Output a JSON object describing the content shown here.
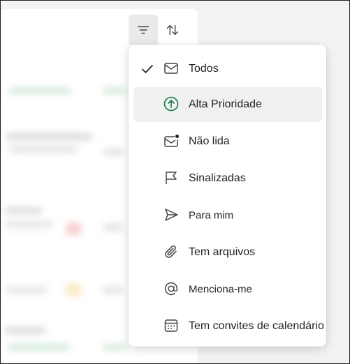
{
  "menu": {
    "items": [
      {
        "label": "Todos",
        "icon": "mail-icon",
        "checked": true
      },
      {
        "label": "Alta Prioridade",
        "icon": "arrow-up-circle-icon",
        "highlighted": true
      },
      {
        "label": "Não lida",
        "icon": "mail-unread-icon"
      },
      {
        "label": "Sinalizadas",
        "icon": "flag-icon"
      },
      {
        "label": "Para mim",
        "icon": "send-icon"
      },
      {
        "label": "Tem arquivos",
        "icon": "attach-icon"
      },
      {
        "label": "Menciona-me",
        "icon": "mention-icon"
      },
      {
        "label": "Tem convites de calendário",
        "icon": "calendar-icon"
      }
    ]
  },
  "toolbar": {
    "filter_icon": "filter-icon",
    "sort_icon": "sort-icon"
  },
  "colors": {
    "accent_green": "#107c41",
    "hover_bg": "#f0f0f0"
  }
}
